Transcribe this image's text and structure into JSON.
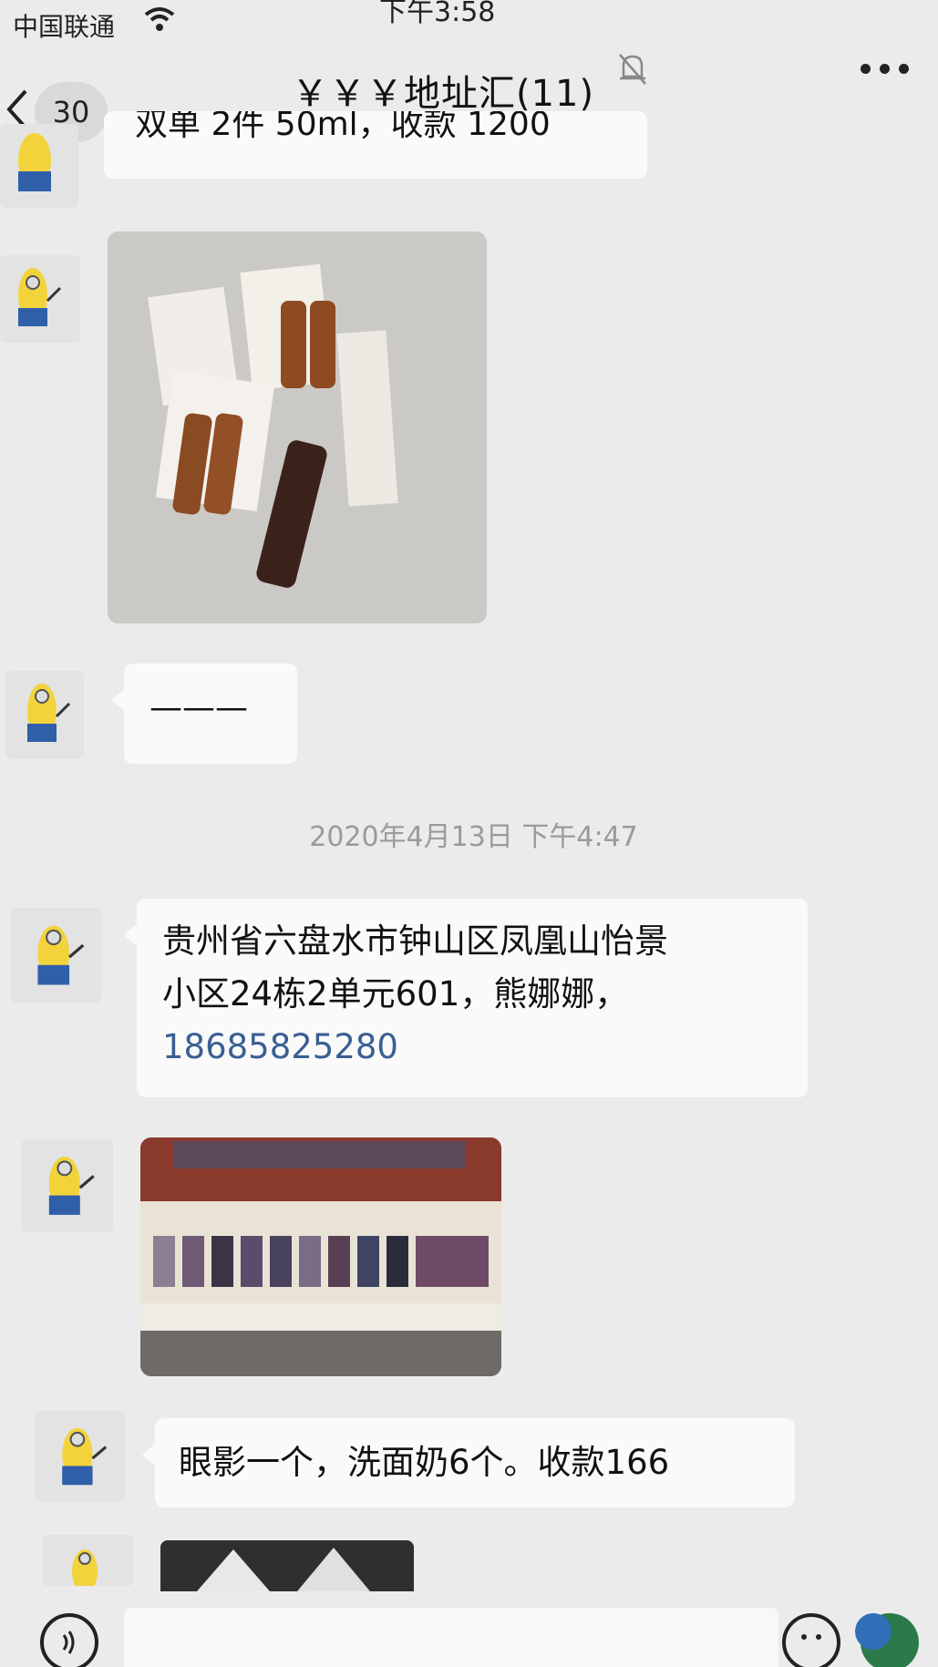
{
  "status_bar": {
    "carrier": "中国联通",
    "time": "下午3:58"
  },
  "nav": {
    "unread_count": "30",
    "title": "￥￥￥地址汇(11)",
    "back_icon": "chevron-left-icon",
    "mute_icon": "bell-muted-icon",
    "more_icon": "more-dots-icon"
  },
  "messages": [
    {
      "type": "text",
      "text": "双单 2件 50ml，收款 1200"
    },
    {
      "type": "image",
      "alt": "Clarins Double Serum boxes and bottle"
    },
    {
      "type": "text",
      "text": "———"
    },
    {
      "type": "timestamp",
      "text": "2020年4月13日 下午4:47"
    },
    {
      "type": "text",
      "text_line1": "贵州省六盘水市钟山区凤凰山怡景",
      "text_line2": "小区24栋2单元601，熊娜娜，",
      "phone": "18685825280"
    },
    {
      "type": "image",
      "alt": "Eyeshadow palette"
    },
    {
      "type": "text",
      "text": "眼影一个，洗面奶6个。收款166"
    },
    {
      "type": "image",
      "alt": "Partial product photo"
    }
  ],
  "input_bar": {
    "voice_icon": "voice-icon",
    "emoji_icon": "emoji-icon",
    "plus_icon": "plus-icon"
  },
  "colors": {
    "background": "#ebebeb",
    "bubble": "#fafafa",
    "link": "#3a5f93",
    "timestamp": "#9a9a9a"
  }
}
